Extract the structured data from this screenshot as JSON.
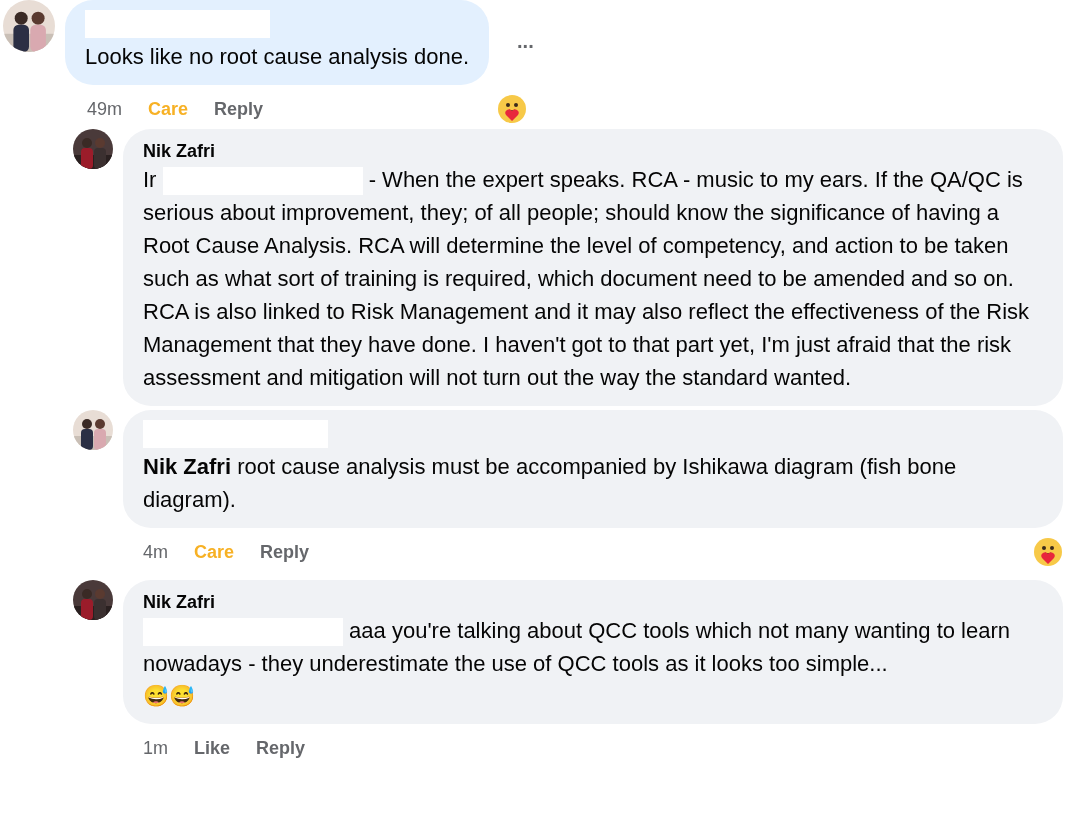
{
  "comments": [
    {
      "author_redacted": true,
      "own": true,
      "segments": [
        {
          "kind": "text",
          "text": "Looks like no root cause analysis done."
        }
      ],
      "menu": "...",
      "time": "49m",
      "reaction": {
        "label": "Care",
        "reacted": true
      },
      "reply": "Reply",
      "care_emoji": true,
      "children": [
        {
          "author": "Nik Zafri",
          "own": false,
          "segments": [
            {
              "kind": "text",
              "text": "Ir "
            },
            {
              "kind": "redaction"
            },
            {
              "kind": "text",
              "text": " - When the expert speaks. RCA - music to my ears. If the QA/QC is serious about improvement, they; of all people; should know the significance of having a Root Cause Analysis. RCA will determine the level of competency, and action to be taken such as what sort of training is required, which document need to be amended and so on. RCA is also linked to Risk Management and it may also reflect the effectiveness of the Risk Management that they have done. I haven't got to that part yet, I'm just afraid that the risk assessment and mitigation will not turn out the way the standard wanted."
            }
          ]
        },
        {
          "author_redacted": true,
          "own": false,
          "segments": [
            {
              "kind": "mention",
              "text": "Nik Zafri"
            },
            {
              "kind": "text",
              "text": " root cause analysis must be accompanied by Ishikawa diagram (fish bone diagram)."
            }
          ],
          "time": "4m",
          "reaction": {
            "label": "Care",
            "reacted": true
          },
          "reply": "Reply",
          "care_emoji": true
        },
        {
          "author": "Nik Zafri",
          "own": false,
          "segments": [
            {
              "kind": "redaction"
            },
            {
              "kind": "text",
              "text": " aaa you're talking about QCC tools which not many wanting to learn nowadays - they underestimate the use of QCC tools as it looks too simple..."
            }
          ],
          "emoji_line": "😅😅",
          "time": "1m",
          "reaction": {
            "label": "Like",
            "reacted": false
          },
          "reply": "Reply"
        }
      ]
    }
  ]
}
